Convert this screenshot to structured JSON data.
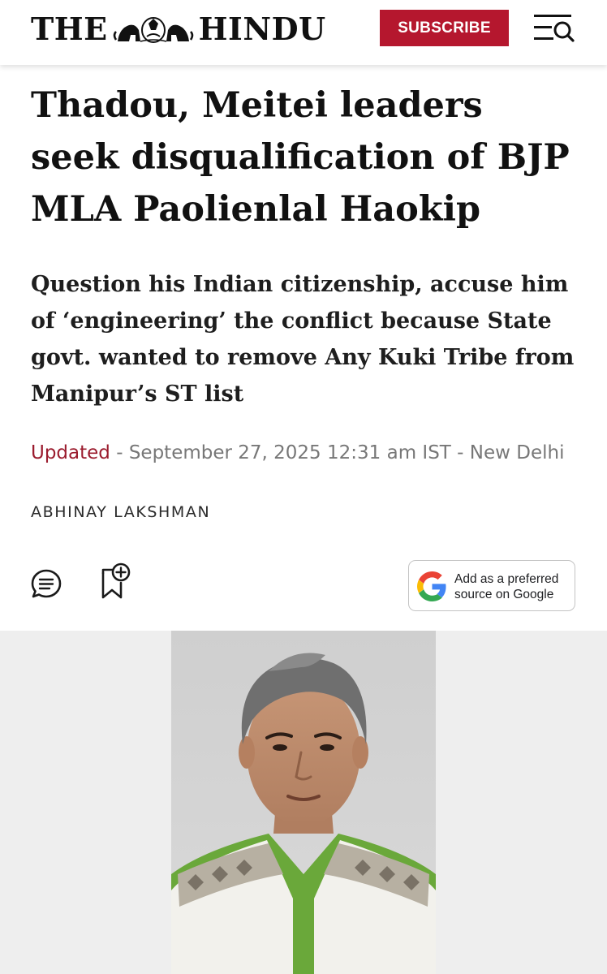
{
  "header": {
    "logo_left": "THE",
    "logo_right": "HINDU",
    "subscribe_label": "SUBSCRIBE"
  },
  "article": {
    "headline": "Thadou, Meitei leaders seek disqualification of BJP MLA Paolienlal Haokip",
    "subheadline": "Question his Indian citizenship, accuse him of ‘engineering’ the conflict because State govt. wanted to remove Any Kuki Tribe from Manipur’s ST list",
    "meta": {
      "updated_label": "Updated",
      "separator": " - ",
      "timestamp": "September 27, 2025 12:31 am IST",
      "location": "New Delhi"
    },
    "byline": "ABHINAY LAKSHMAN"
  },
  "actions": {
    "google_pref_line1": "Add as a preferred",
    "google_pref_line2": "source on Google"
  },
  "icons": {
    "menu": "menu-search-icon",
    "comment": "comment-icon",
    "bookmark": "bookmark-add-icon",
    "google": "google-g-icon"
  },
  "colors": {
    "brand_red": "#b5172e",
    "updated_red": "#9b1c2e",
    "meta_gray": "#777777",
    "photo_background": "#eeeeee"
  }
}
